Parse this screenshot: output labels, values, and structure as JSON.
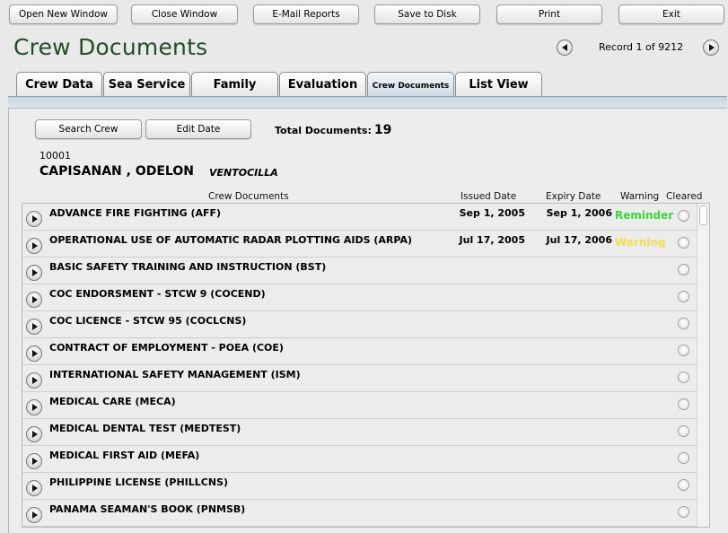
{
  "toolbar": {
    "open_new_window": "Open New Window",
    "close_window": "Close Window",
    "email_reports": "E-Mail Reports",
    "save_to_disk": "Save to Disk",
    "print": "Print",
    "exit": "Exit"
  },
  "header": {
    "title": "Crew Documents",
    "record_counter": "Record 1 of 9212"
  },
  "tabs": [
    {
      "label": "Crew Data"
    },
    {
      "label": "Sea Service"
    },
    {
      "label": "Family"
    },
    {
      "label": "Evaluation"
    },
    {
      "label": "Crew Documents"
    },
    {
      "label": "List View"
    }
  ],
  "actions": {
    "search_crew": "Search Crew",
    "edit_date": "Edit Date"
  },
  "summary": {
    "total_label": "Total Documents:",
    "total_value": "19"
  },
  "crew": {
    "id": "10001",
    "name": "CAPISANAN , ODELON",
    "middle_name": "VENTOCILLA"
  },
  "columns": {
    "documents": "Crew Documents",
    "issued": "Issued Date",
    "expiry": "Expiry Date",
    "warning": "Warning",
    "cleared": "Cleared"
  },
  "colors": {
    "title_green": "#1f4f22",
    "reminder": "#33dd33",
    "warning": "#f3e04a"
  },
  "documents": [
    {
      "name": "ADVANCE FIRE FIGHTING (AFF)",
      "issued": "Sep 1, 2005",
      "expiry": "Sep 1, 2006",
      "warning": "Reminder",
      "warning_type": "reminder"
    },
    {
      "name": "OPERATIONAL USE OF AUTOMATIC RADAR PLOTTING AIDS (ARPA)",
      "issued": "Jul 17, 2005",
      "expiry": "Jul 17, 2006",
      "warning": "Warning",
      "warning_type": "warning"
    },
    {
      "name": "BASIC SAFETY TRAINING AND INSTRUCTION (BST)",
      "issued": "",
      "expiry": "",
      "warning": "",
      "warning_type": ""
    },
    {
      "name": "COC ENDORSMENT - STCW 9 (COCEND)",
      "issued": "",
      "expiry": "",
      "warning": "",
      "warning_type": ""
    },
    {
      "name": "COC LICENCE - STCW 95 (COCLCNS)",
      "issued": "",
      "expiry": "",
      "warning": "",
      "warning_type": ""
    },
    {
      "name": "CONTRACT OF EMPLOYMENT - POEA (COE)",
      "issued": "",
      "expiry": "",
      "warning": "",
      "warning_type": ""
    },
    {
      "name": "INTERNATIONAL SAFETY MANAGEMENT (ISM)",
      "issued": "",
      "expiry": "",
      "warning": "",
      "warning_type": ""
    },
    {
      "name": "MEDICAL CARE (MECA)",
      "issued": "",
      "expiry": "",
      "warning": "",
      "warning_type": ""
    },
    {
      "name": "MEDICAL DENTAL TEST (MEDTEST)",
      "issued": "",
      "expiry": "",
      "warning": "",
      "warning_type": ""
    },
    {
      "name": "MEDICAL FIRST AID (MEFA)",
      "issued": "",
      "expiry": "",
      "warning": "",
      "warning_type": ""
    },
    {
      "name": "PHILIPPINE LICENSE (PHILLCNS)",
      "issued": "",
      "expiry": "",
      "warning": "",
      "warning_type": ""
    },
    {
      "name": "PANAMA SEAMAN'S BOOK (PNMSB)",
      "issued": "",
      "expiry": "",
      "warning": "",
      "warning_type": ""
    }
  ]
}
